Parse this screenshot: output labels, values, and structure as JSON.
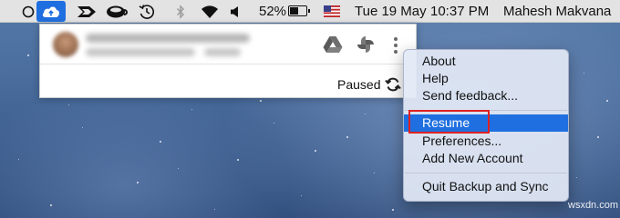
{
  "menubar": {
    "battery_percent": "52%",
    "date": "Tue 19 May",
    "time": "10:37 PM",
    "user": "Mahesh Makvana",
    "icons": [
      "circle-icon",
      "backup-cloud-icon",
      "arrow-app-icon",
      "coffee-cup-icon",
      "time-machine-icon",
      "bluetooth-icon",
      "wifi-icon",
      "volume-icon",
      "battery-icon",
      "us-flag-icon"
    ]
  },
  "panel": {
    "status": "Paused",
    "icons": [
      "avatar",
      "google-drive-icon",
      "google-photos-icon",
      "more-vert-icon",
      "sync-icon"
    ]
  },
  "context_menu": {
    "items": [
      {
        "label": "About"
      },
      {
        "label": "Help"
      },
      {
        "label": "Send feedback..."
      },
      {
        "label": "Resume",
        "selected": true
      },
      {
        "label": "Preferences..."
      },
      {
        "label": "Add New Account"
      },
      {
        "label": "Quit Backup and Sync"
      }
    ]
  },
  "colors": {
    "accent": "#1f6fe0",
    "highlight_box": "#e02020"
  },
  "watermark": "wsxdn.com"
}
